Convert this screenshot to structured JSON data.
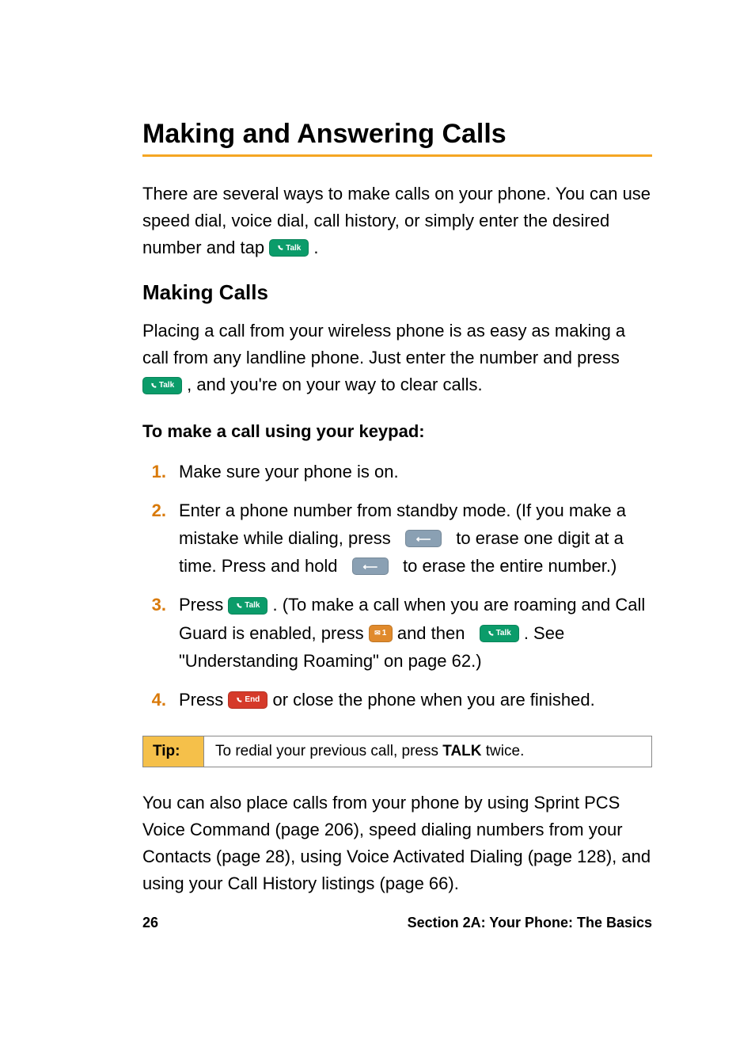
{
  "title": "Making and Answering Calls",
  "intro_pre": "There are several ways to make calls on your phone. You can use speed dial, voice dial, call history, or simply enter the desired number and tap ",
  "intro_post": " .",
  "subtitle": "Making Calls",
  "para1_pre": "Placing a call from your wireless phone is as easy as making a call from any landline phone. Just enter the number and press ",
  "para1_post": " , and you're on your way to clear calls.",
  "howto_heading": "To make a call using your keypad:",
  "steps": {
    "n1": "1.",
    "s1": "Make sure your phone is on.",
    "n2": "2.",
    "s2_a": "Enter a phone number from standby mode. (If you make a mistake while dialing, press ",
    "s2_b": " to erase one digit at a time. Press and hold ",
    "s2_c": " to erase the entire number.)",
    "n3": "3.",
    "s3_a": "Press ",
    "s3_b": " . (To make a call when you are roaming and Call Guard is enabled, press ",
    "s3_c": " and then ",
    "s3_d": " . See \"Understanding Roaming\" on page 62.)",
    "n4": "4.",
    "s4_a": "Press ",
    "s4_b": " or close the phone when you are finished."
  },
  "tip": {
    "label": "Tip:",
    "text_pre": "To redial your previous call, press ",
    "text_bold": "TALK",
    "text_post": " twice."
  },
  "closing": "You can also place calls from your phone by using Sprint PCS Voice Command (page 206), speed dialing numbers from your Contacts (page 28), using Voice Activated Dialing (page 128), and using your Call History listings (page 66).",
  "footer": {
    "page": "26",
    "section": "Section 2A: Your Phone: The Basics"
  },
  "keys": {
    "talk": "Talk",
    "end": "End",
    "one": "1"
  }
}
